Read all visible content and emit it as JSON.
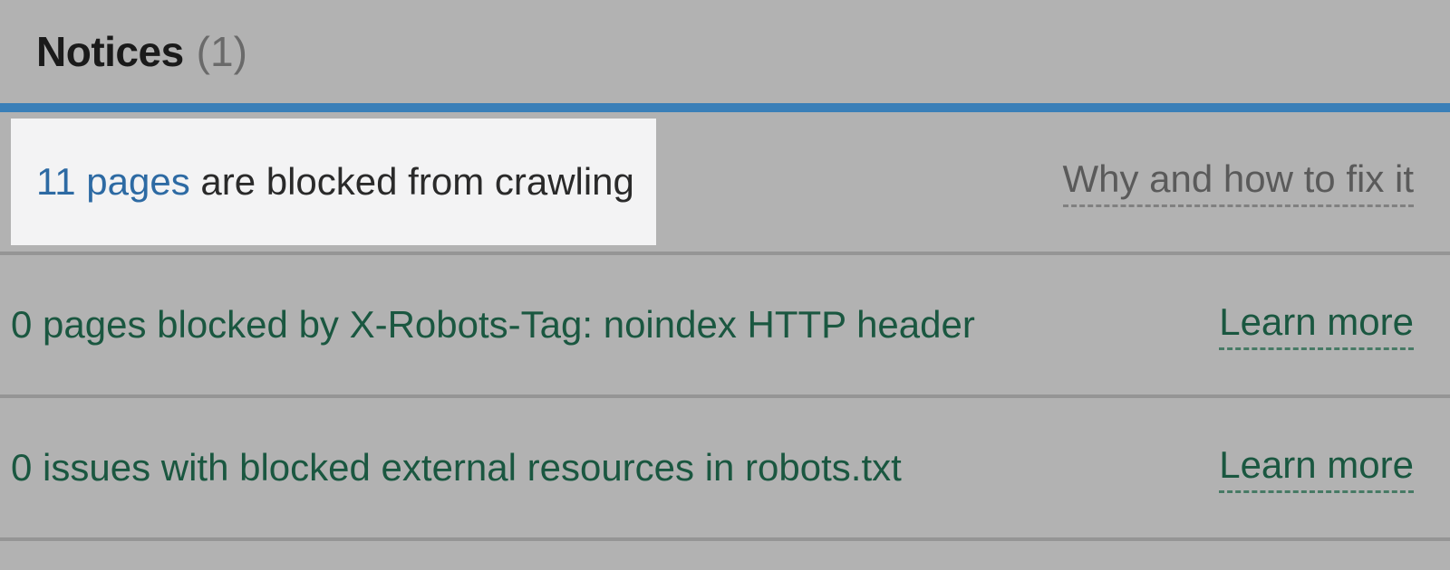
{
  "header": {
    "title": "Notices",
    "count": "(1)"
  },
  "rows": [
    {
      "pages_link": "11 pages",
      "rest_text": " are blocked from crawling",
      "help_label": "Why and how to fix it"
    },
    {
      "text": "0 pages blocked by X-Robots-Tag: noindex HTTP header",
      "help_label": "Learn more"
    },
    {
      "text": "0 issues with blocked external resources in robots.txt",
      "help_label": "Learn more"
    }
  ]
}
